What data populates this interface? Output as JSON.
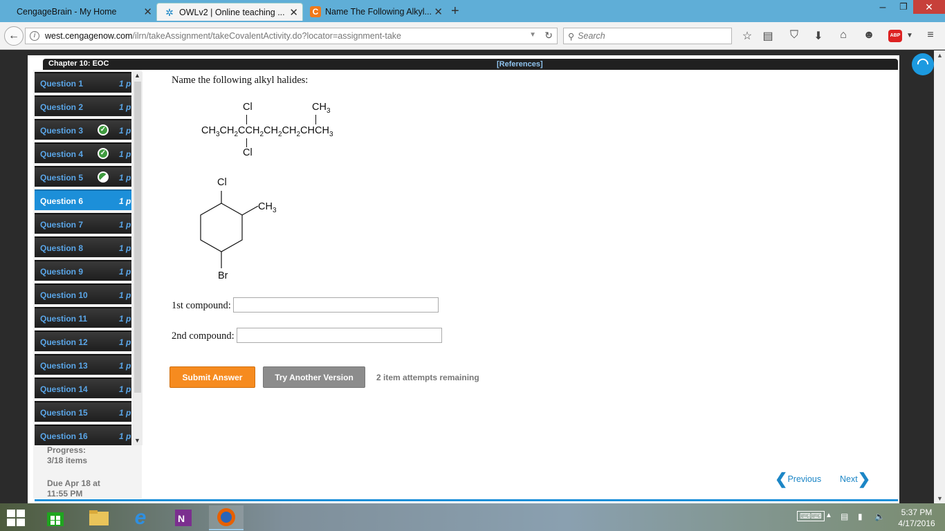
{
  "browser": {
    "tabs": [
      {
        "title": "CengageBrain - My Home",
        "active": false
      },
      {
        "title": "OWLv2 | Online teaching ...",
        "active": true
      },
      {
        "title": "Name The Following Alkyl...",
        "active": false
      }
    ],
    "url": {
      "host": "west.cengagenow.com",
      "path": "/ilrn/takeAssignment/takeCovalentActivity.do?locator=assignment-take"
    },
    "search_placeholder": "Search",
    "abp_label": "ABP"
  },
  "assignment": {
    "chapter": "Chapter 10: EOC",
    "references": "[References]",
    "questions": [
      {
        "label": "Question 1",
        "points": "1 p",
        "status": "none"
      },
      {
        "label": "Question 2",
        "points": "1 p",
        "status": "none"
      },
      {
        "label": "Question 3",
        "points": "1 p",
        "status": "correct"
      },
      {
        "label": "Question 4",
        "points": "1 p",
        "status": "correct"
      },
      {
        "label": "Question 5",
        "points": "1 p",
        "status": "partial"
      },
      {
        "label": "Question 6",
        "points": "1 p",
        "status": "active"
      },
      {
        "label": "Question 7",
        "points": "1 p",
        "status": "none"
      },
      {
        "label": "Question 8",
        "points": "1 p",
        "status": "none"
      },
      {
        "label": "Question 9",
        "points": "1 p",
        "status": "none"
      },
      {
        "label": "Question 10",
        "points": "1 p",
        "status": "none"
      },
      {
        "label": "Question 11",
        "points": "1 p",
        "status": "none"
      },
      {
        "label": "Question 12",
        "points": "1 p",
        "status": "none"
      },
      {
        "label": "Question 13",
        "points": "1 p",
        "status": "none"
      },
      {
        "label": "Question 14",
        "points": "1 p",
        "status": "none"
      },
      {
        "label": "Question 15",
        "points": "1 p",
        "status": "none"
      },
      {
        "label": "Question 16",
        "points": "1 p",
        "status": "none"
      }
    ],
    "progress_label": "Progress:",
    "progress_value": "3/18 items",
    "due_line1": "Due Apr 18 at",
    "due_line2": "11:55 PM"
  },
  "question": {
    "prompt": "Name the following alkyl halides:",
    "compound1": {
      "top_sub1": "Cl",
      "top_sub2": "CH3",
      "chain": "CH3CH2CCH2CH2CH2CHCH3",
      "bottom_sub": "Cl"
    },
    "compound2": {
      "top": "Cl",
      "side": "CH3",
      "bottom": "Br"
    },
    "answer1_label": "1st compound:",
    "answer1_value": "",
    "answer2_label": "2nd compound:",
    "answer2_value": "",
    "submit_label": "Submit Answer",
    "try_label": "Try Another Version",
    "attempts": "2 item attempts remaining",
    "prev_label": "Previous",
    "next_label": "Next"
  },
  "taskbar": {
    "time": "5:37 PM",
    "date": "4/17/2016"
  },
  "colors": {
    "accent_blue": "#1c8fd9",
    "submit_orange": "#f68b1f",
    "try_gray": "#8c8c8c",
    "link_blue": "#1c86c6",
    "check_green": "#3f9b3f"
  }
}
